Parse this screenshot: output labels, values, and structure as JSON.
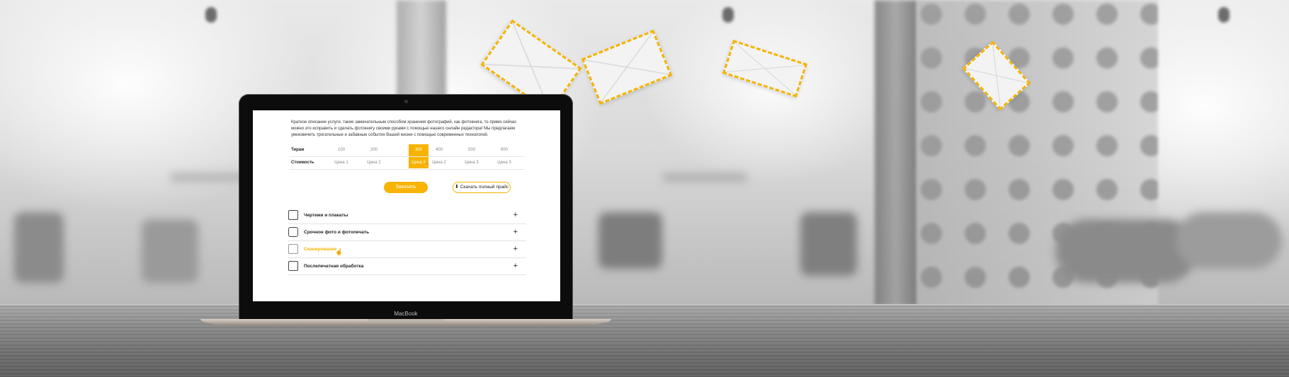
{
  "laptop": {
    "brand": "MacBook"
  },
  "page": {
    "description": "Краткое описание услуги. такие замечательным способом хранения фотографий, как фотокнига, то прямо сейчас можно это исправить и сделать фотокнигу своими руками с помощью нашего онлайн редактора! Мы предлагаем увековечить трогательные и забавные события Вашей жизни с помощью современных технологий."
  },
  "price_table": {
    "rows": [
      {
        "label": "Тираж",
        "cells": [
          "100",
          "200",
          "300",
          "400",
          "500",
          "600"
        ]
      },
      {
        "label": "Стоимость",
        "cells": [
          "Цена 1",
          "Цена 2",
          "Цена 3",
          "Цена 2",
          "Цена 3",
          "Цена 3"
        ]
      }
    ],
    "selected_column": 2
  },
  "buttons": {
    "order": "Заказать",
    "download_price": "Скачать полный прайс",
    "download_icon": "download-icon"
  },
  "services": [
    {
      "label": "Чертежи и плакаты",
      "icon": "plotter-icon",
      "active": false
    },
    {
      "label": "Срочное фото и фотопечать",
      "icon": "camera-icon",
      "active": false
    },
    {
      "label": "Сканирование",
      "icon": "scanner-icon",
      "active": true
    },
    {
      "label": "Послепечатная обработка",
      "icon": "notebook-icon",
      "active": false
    }
  ],
  "colors": {
    "accent": "#f8b300"
  }
}
